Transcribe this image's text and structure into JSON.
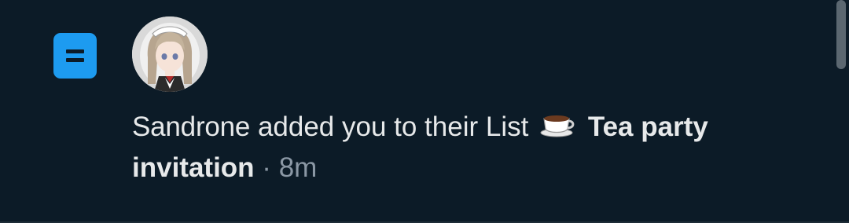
{
  "notification": {
    "type_icon": "list-icon",
    "avatar": "user-avatar",
    "user_name": "Sandrone",
    "action_text": "added you to their List",
    "list_emoji_icon": "tea-cup-icon",
    "list_name": "Tea party invitation",
    "separator": "·",
    "time_ago": "8m"
  },
  "colors": {
    "background": "#0c1b27",
    "accent": "#1d9bf0",
    "text": "#e7e9ea",
    "muted": "#8b98a5"
  }
}
